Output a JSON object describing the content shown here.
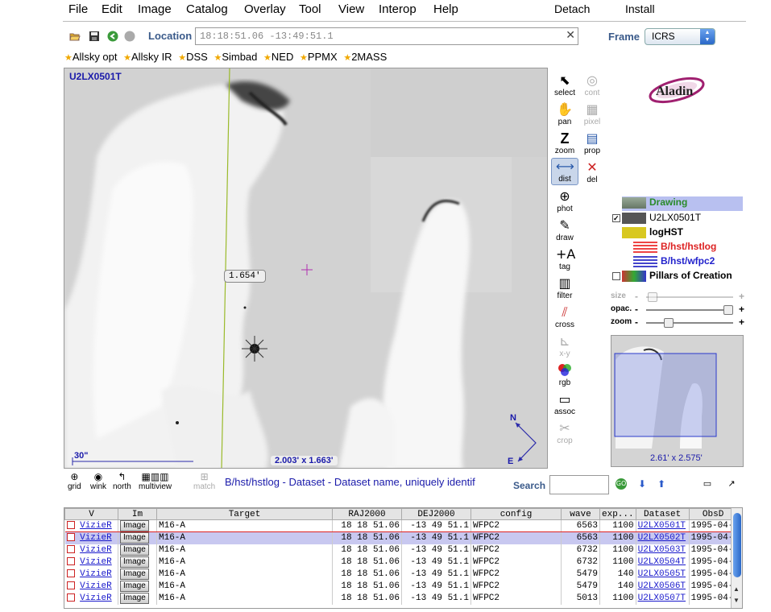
{
  "menu": {
    "items": [
      "File",
      "Edit",
      "Image",
      "Catalog",
      "Overlay",
      "Tool",
      "View",
      "Interop",
      "Help"
    ],
    "right": [
      "Detach",
      "Install"
    ]
  },
  "toolbar": {
    "location_label": "Location",
    "location_value": "18:18:51.06 -13:49:51.1",
    "frame_label": "Frame",
    "frame_value": "ICRS"
  },
  "bookmarks": [
    "Allsky opt",
    "Allsky IR",
    "DSS",
    "Simbad",
    "NED",
    "PPMX",
    "2MASS"
  ],
  "viewer": {
    "image_label": "U2LX0501T",
    "distance": "1.654'",
    "fov": "2.003' x 1.663'",
    "scale": "30\"",
    "compass_n": "N",
    "compass_e": "E"
  },
  "tools": [
    {
      "label": "select",
      "icon": "arrow-icon",
      "enabled": true
    },
    {
      "label": "cont",
      "icon": "contour-icon",
      "enabled": false
    },
    {
      "label": "pan",
      "icon": "hand-icon",
      "enabled": true
    },
    {
      "label": "pixel",
      "icon": "pixel-icon",
      "enabled": false
    },
    {
      "label": "zoom",
      "icon": "zoom-icon",
      "enabled": true
    },
    {
      "label": "prop",
      "icon": "properties-icon",
      "enabled": true
    },
    {
      "label": "dist",
      "icon": "distance-icon",
      "enabled": true,
      "active": true
    },
    {
      "label": "del",
      "icon": "delete-icon",
      "enabled": true
    },
    {
      "label": "phot",
      "icon": "photometry-icon",
      "enabled": true
    },
    {
      "label": "draw",
      "icon": "pencil-icon",
      "enabled": true
    },
    {
      "label": "tag",
      "icon": "tag-icon",
      "enabled": true
    },
    {
      "label": "filter",
      "icon": "filter-icon",
      "enabled": true
    },
    {
      "label": "cross",
      "icon": "crossmatch-icon",
      "enabled": true
    },
    {
      "label": "x-y",
      "icon": "plot-icon",
      "enabled": false
    },
    {
      "label": "rgb",
      "icon": "rgb-icon",
      "enabled": true
    },
    {
      "label": "assoc",
      "icon": "film-icon",
      "enabled": true
    },
    {
      "label": "crop",
      "icon": "scissors-icon",
      "enabled": false
    }
  ],
  "stack": {
    "layers": [
      {
        "name": "Drawing",
        "color": "#2a8a2a"
      },
      {
        "name": "U2LX0501T",
        "color": "#000000"
      },
      {
        "name": "logHST",
        "color": "#000000"
      },
      {
        "name": "B/hst/hstlog",
        "color": "#dd2222"
      },
      {
        "name": "B/hst/wfpc2",
        "color": "#2222cc"
      },
      {
        "name": "Pillars of Creation",
        "color": "#000000"
      }
    ],
    "sliders": [
      {
        "label": "size",
        "value": 0.05
      },
      {
        "label": "opac.",
        "value": 0.95
      },
      {
        "label": "zoom",
        "value": 0.25
      }
    ]
  },
  "panner": {
    "label": "2.61' x 2.575'"
  },
  "bottom_tools": [
    "grid",
    "wink",
    "north",
    "multiview",
    "match"
  ],
  "status": "B/hst/hstlog - Dataset - Dataset name, uniquely identif",
  "search": {
    "label": "Search"
  },
  "table": {
    "columns": [
      "V",
      "Im",
      "Target",
      "RAJ2000",
      "DEJ2000",
      "config",
      "wave",
      "exp...",
      "Dataset",
      "ObsD"
    ],
    "rows": [
      {
        "v": "VizieR",
        "im": "Image",
        "target": "M16-A",
        "ra": "18 18 51.06",
        "de": "-13 49 51.1",
        "config": "WFPC2",
        "wave": "6563",
        "exp": "1100",
        "dataset": "U2LX0501T",
        "obs": "1995-04-"
      },
      {
        "v": "VizieR",
        "im": "Image",
        "target": "M16-A",
        "ra": "18 18 51.06",
        "de": "-13 49 51.1",
        "config": "WFPC2",
        "wave": "6563",
        "exp": "1100",
        "dataset": "U2LX0502T",
        "obs": "1995-04-"
      },
      {
        "v": "VizieR",
        "im": "Image",
        "target": "M16-A",
        "ra": "18 18 51.06",
        "de": "-13 49 51.1",
        "config": "WFPC2",
        "wave": "6732",
        "exp": "1100",
        "dataset": "U2LX0503T",
        "obs": "1995-04-"
      },
      {
        "v": "VizieR",
        "im": "Image",
        "target": "M16-A",
        "ra": "18 18 51.06",
        "de": "-13 49 51.1",
        "config": "WFPC2",
        "wave": "6732",
        "exp": "1100",
        "dataset": "U2LX0504T",
        "obs": "1995-04-"
      },
      {
        "v": "VizieR",
        "im": "Image",
        "target": "M16-A",
        "ra": "18 18 51.06",
        "de": "-13 49 51.1",
        "config": "WFPC2",
        "wave": "5479",
        "exp": "140",
        "dataset": "U2LX0505T",
        "obs": "1995-04-"
      },
      {
        "v": "VizieR",
        "im": "Image",
        "target": "M16-A",
        "ra": "18 18 51.06",
        "de": "-13 49 51.1",
        "config": "WFPC2",
        "wave": "5479",
        "exp": "140",
        "dataset": "U2LX0506T",
        "obs": "1995-04-"
      },
      {
        "v": "VizieR",
        "im": "Image",
        "target": "M16-A",
        "ra": "18 18 51.06",
        "de": "-13 49 51.1",
        "config": "WFPC2",
        "wave": "5013",
        "exp": "1100",
        "dataset": "U2LX0507T",
        "obs": "1995-04-"
      }
    ]
  }
}
